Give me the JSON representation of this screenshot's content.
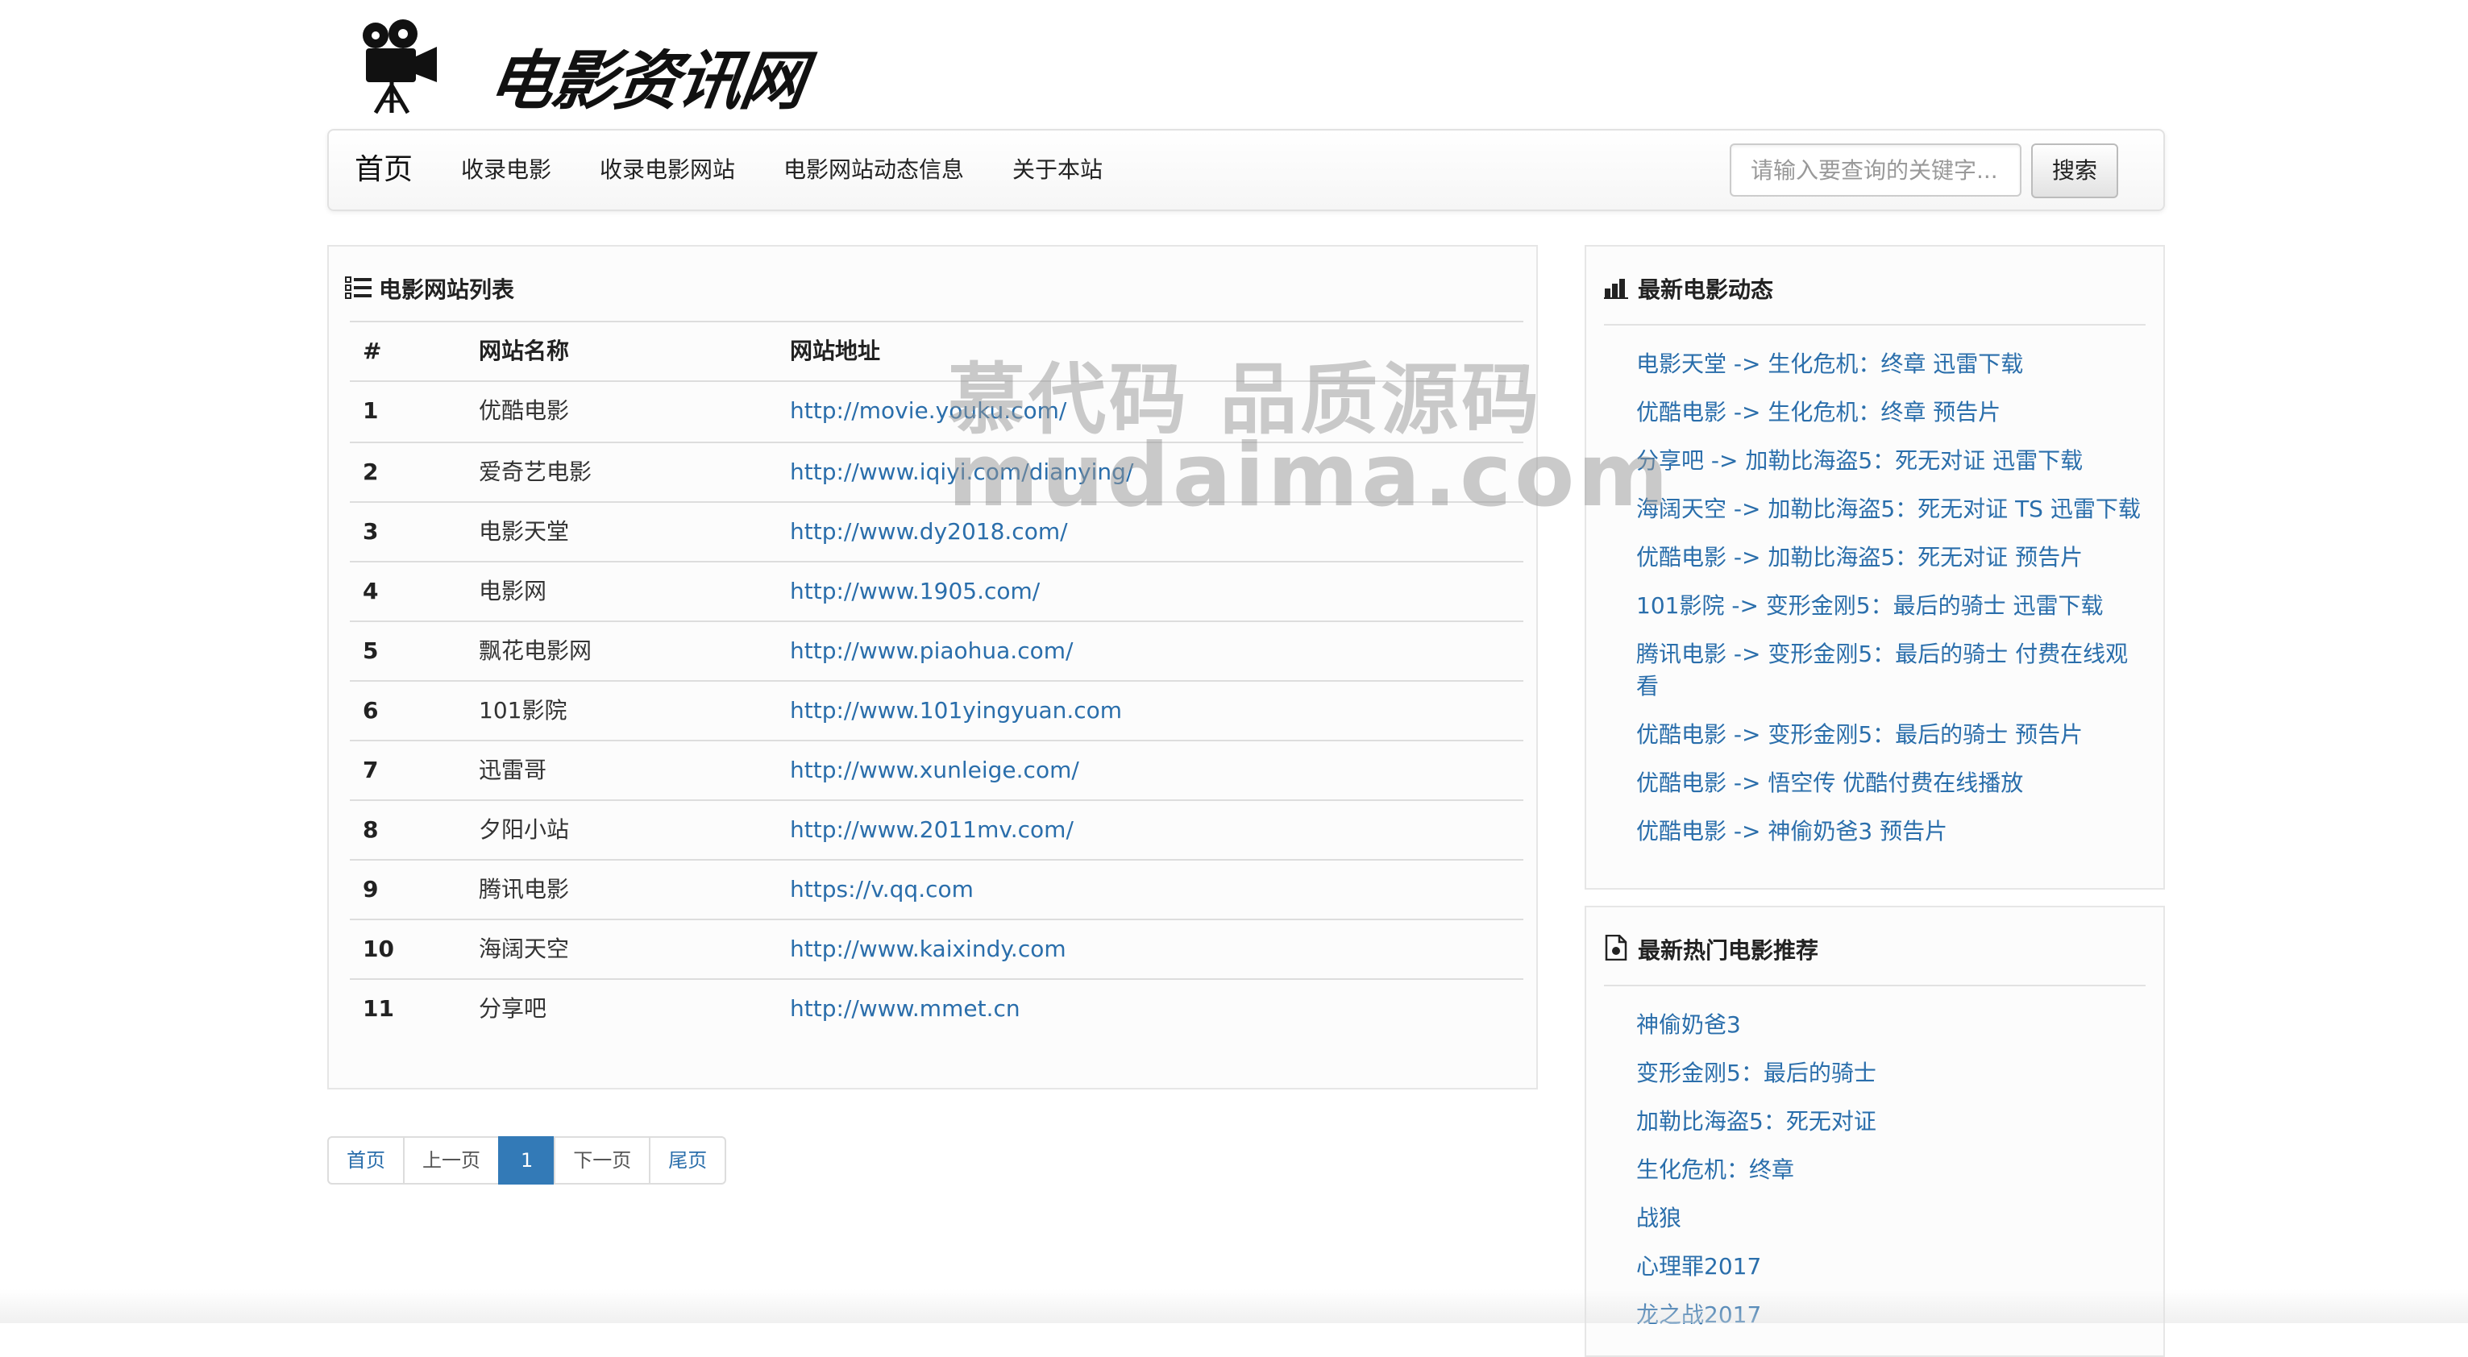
{
  "logo": {
    "text": "电影资讯网"
  },
  "navbar": {
    "brand": "首页",
    "items": [
      "收录电影",
      "收录电影网站",
      "电影网站动态信息",
      "关于本站"
    ],
    "search_placeholder": "请输入要查询的关键字...",
    "search_button": "搜索"
  },
  "site_list": {
    "title": "电影网站列表",
    "icon": "list-icon",
    "columns": [
      "#",
      "网站名称",
      "网站地址"
    ],
    "rows": [
      [
        "1",
        "优酷电影",
        "http://movie.youku.com/"
      ],
      [
        "2",
        "爱奇艺电影",
        "http://www.iqiyi.com/dianying/"
      ],
      [
        "3",
        "电影天堂",
        "http://www.dy2018.com/"
      ],
      [
        "4",
        "电影网",
        "http://www.1905.com/"
      ],
      [
        "5",
        "飘花电影网",
        "http://www.piaohua.com/"
      ],
      [
        "6",
        "101影院",
        "http://www.101yingyuan.com"
      ],
      [
        "7",
        "迅雷哥",
        "http://www.xunleige.com/"
      ],
      [
        "8",
        "夕阳小站",
        "http://www.2011mv.com/"
      ],
      [
        "9",
        "腾讯电影",
        "https://v.qq.com"
      ],
      [
        "10",
        "海阔天空",
        "http://www.kaixindy.com"
      ],
      [
        "11",
        "分享吧",
        "http://www.mmet.cn"
      ]
    ]
  },
  "pagination": {
    "first": "首页",
    "prev": "上一页",
    "current": "1",
    "next": "下一页",
    "last": "尾页"
  },
  "latest_news": {
    "title": "最新电影动态",
    "icon": "bar-chart-icon",
    "items": [
      "电影天堂 -> 生化危机：终章 迅雷下载",
      "优酷电影 -> 生化危机：终章 预告片",
      "分享吧 -> 加勒比海盗5：死无对证 迅雷下载",
      "海阔天空 -> 加勒比海盗5：死无对证 TS 迅雷下载",
      "优酷电影 -> 加勒比海盗5：死无对证 预告片",
      "101影院 -> 变形金刚5：最后的骑士 迅雷下载",
      "腾讯电影 -> 变形金刚5：最后的骑士 付费在线观看",
      "优酷电影 -> 变形金刚5：最后的骑士 预告片",
      "优酷电影 -> 悟空传 优酷付费在线播放",
      "优酷电影 -> 神偷奶爸3 预告片"
    ]
  },
  "hot_movies": {
    "title": "最新热门电影推荐",
    "icon": "document-icon",
    "items": [
      "神偷奶爸3",
      "变形金刚5：最后的骑士",
      "加勒比海盗5：死无对证",
      "生化危机：终章",
      "战狼",
      "心理罪2017",
      "龙之战2017"
    ]
  },
  "watermark": {
    "line1": "慕代码 品质源码",
    "line2": "mudaima.com"
  },
  "colors": {
    "link": "#2a6eab",
    "active_page": "#337ab7",
    "border": "#dddddd"
  }
}
